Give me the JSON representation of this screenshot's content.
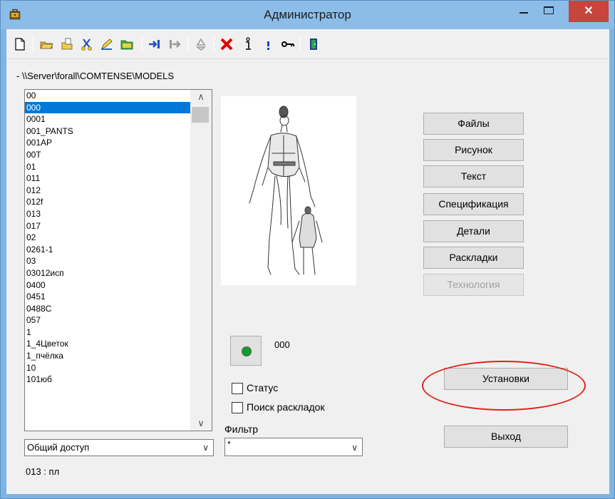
{
  "window": {
    "title": "Администратор",
    "close_symbol": "✕"
  },
  "toolbar": {
    "buttons": [
      "new-document-icon",
      "open-folder-icon",
      "open-file-icon",
      "cut-tool-icon",
      "edit-pencil-icon",
      "folder-green-icon",
      "import-arrow-icon",
      "export-arrow-icon",
      "recycle-icon",
      "delete-x-icon",
      "info-icon",
      "exclamation-icon",
      "key-icon",
      "exit-door-icon"
    ]
  },
  "path": "- \\\\Server\\forall\\COMTENSE\\MODELS",
  "models_list": {
    "items": [
      "00",
      "000",
      "0001",
      "001_PANTS",
      "001AP",
      "00T",
      "01",
      "011",
      "012",
      "012f",
      "013",
      "017",
      "02",
      "0261-1",
      "03",
      "03012исп",
      "0400",
      "0451",
      "0488C",
      "057",
      "1",
      "1_4Цветок",
      "1_пчёлка",
      "10",
      "101юб"
    ],
    "selected_index": 1,
    "scroll_up": "∧",
    "scroll_down": "∨"
  },
  "access_combo": {
    "value": "Общий доступ",
    "arrow": "∨"
  },
  "status": "013 : пл",
  "right_buttons": {
    "files": "Файлы",
    "drawing": "Рисунок",
    "text": "Текст",
    "specification": "Спецификация",
    "details": "Детали",
    "layouts": "Раскладки",
    "technology": "Технология"
  },
  "current_model": "000",
  "status_indicator_color": "#0ca02a",
  "checkboxes": {
    "status": {
      "label": "Статус",
      "checked": false
    },
    "search_layouts": {
      "label": "Поиск раскладок",
      "checked": false
    }
  },
  "filter": {
    "label": "Фильтр",
    "value": "*",
    "arrow": "∨"
  },
  "settings_button": "Установки",
  "exit_button": "Выход",
  "annotation_color": "#e2231a",
  "accent_color": "#0078d7"
}
